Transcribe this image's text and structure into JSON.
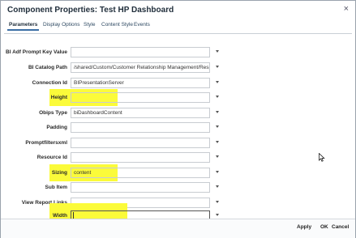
{
  "dialog": {
    "title": "Component Properties: Test HP Dashboard",
    "close_glyph": "×"
  },
  "tabs": [
    {
      "label": "Parameters",
      "active": true
    },
    {
      "label": "Display Options",
      "active": false
    },
    {
      "label": "Style",
      "active": false
    },
    {
      "label": "Content Style",
      "active": false
    },
    {
      "label": "Events",
      "active": false
    }
  ],
  "fields": [
    {
      "label": "BI Adf Prompt Key Value",
      "value": ""
    },
    {
      "label": "BI Catalog Path",
      "value": "/shared/Custom/Customer Relationship Management/Responsive/"
    },
    {
      "label": "Connection Id",
      "value": "BIPresentationServer"
    },
    {
      "label": "Height",
      "value": ""
    },
    {
      "label": "Obips Type",
      "value": "biDashboardContent"
    },
    {
      "label": "Padding",
      "value": ""
    },
    {
      "label": "Promptfiltersxml",
      "value": ""
    },
    {
      "label": "Resource Id",
      "value": ""
    },
    {
      "label": "Sizing",
      "value": "content"
    },
    {
      "label": "Sub Item",
      "value": ""
    },
    {
      "label": "View Report Links",
      "value": "_"
    },
    {
      "label": "Width",
      "value": ""
    }
  ],
  "highlight_color": "#fbfb3a",
  "footer": {
    "apply": "Apply",
    "ok": "OK",
    "cancel": "Cancel"
  }
}
